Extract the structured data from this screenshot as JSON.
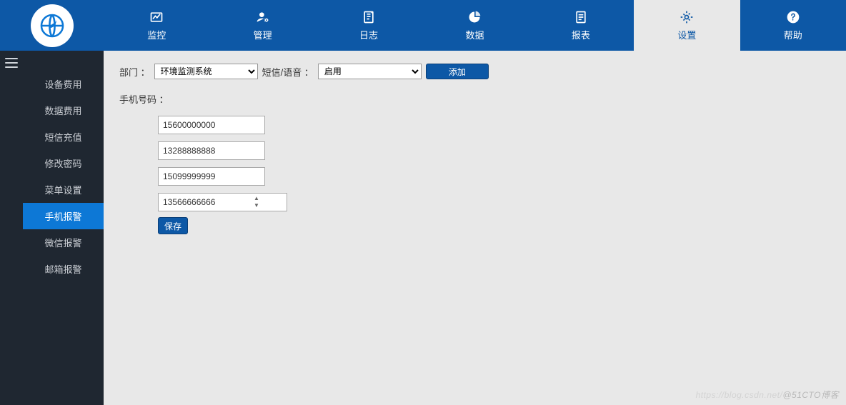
{
  "colors": {
    "primary": "#0d58a6",
    "sidebar_bg": "#1f2731",
    "selected": "#0d78d6"
  },
  "nav": {
    "items": [
      {
        "id": "monitor",
        "label": "监控",
        "icon": "chart-line-icon"
      },
      {
        "id": "manage",
        "label": "管理",
        "icon": "user-gear-icon"
      },
      {
        "id": "log",
        "label": "日志",
        "icon": "journal-icon"
      },
      {
        "id": "data",
        "label": "数据",
        "icon": "pie-chart-icon"
      },
      {
        "id": "report",
        "label": "报表",
        "icon": "document-icon"
      },
      {
        "id": "settings",
        "label": "设置",
        "icon": "gear-icon",
        "active": true
      },
      {
        "id": "help",
        "label": "帮助",
        "icon": "question-icon"
      }
    ]
  },
  "sidebar": {
    "items": [
      {
        "id": "device-fee",
        "label": "设备费用"
      },
      {
        "id": "data-fee",
        "label": "数据费用"
      },
      {
        "id": "sms-recharge",
        "label": "短信充值"
      },
      {
        "id": "change-password",
        "label": "修改密码"
      },
      {
        "id": "menu-settings",
        "label": "菜单设置"
      },
      {
        "id": "phone-alarm",
        "label": "手机报警",
        "selected": true
      },
      {
        "id": "wechat-alarm",
        "label": "微信报警"
      },
      {
        "id": "email-alarm",
        "label": "邮箱报警"
      }
    ]
  },
  "form": {
    "dept_label": "部门 ：",
    "dept_value": "环境监测系统",
    "voice_label": "短信/语音 ：",
    "voice_value": "启用",
    "add_label": "添加",
    "phones_label": "手机号码 ：",
    "phones": [
      "15600000000",
      "13288888888",
      "15099999999",
      "13566666666"
    ],
    "save_label": "保存"
  },
  "watermark": {
    "faded": "https://blog.csdn.net/",
    "solid": "@51CTO博客"
  }
}
